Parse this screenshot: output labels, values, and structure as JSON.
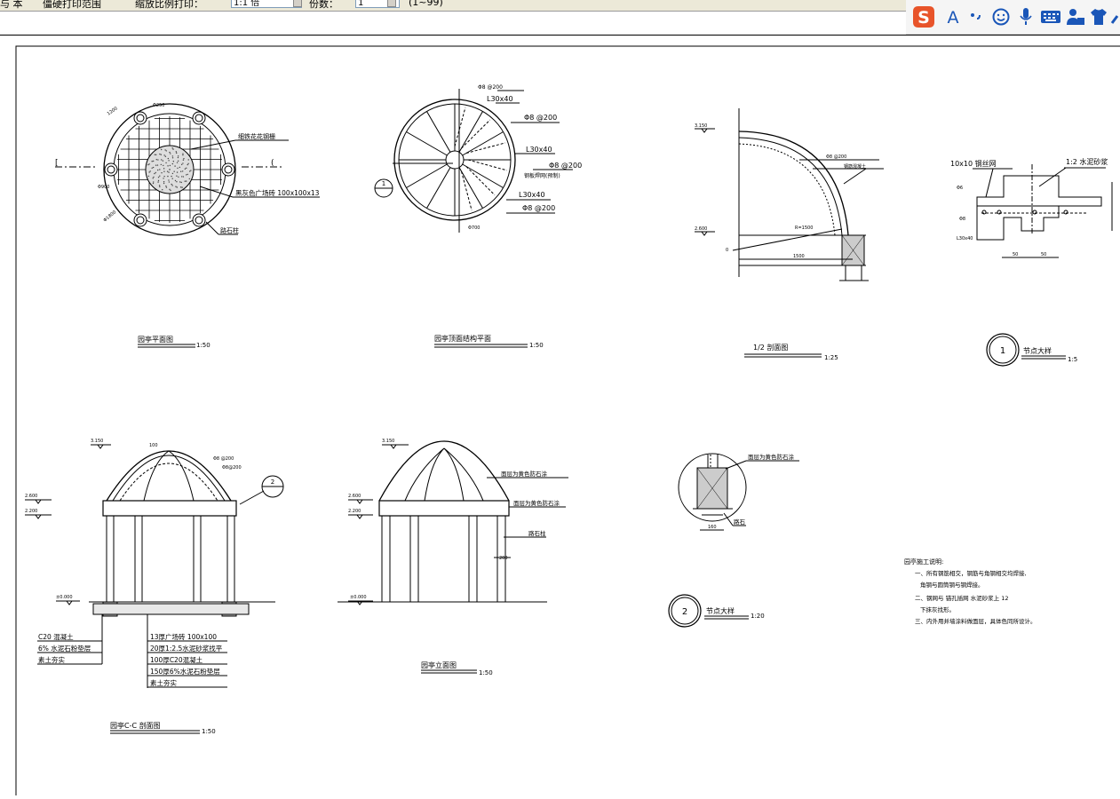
{
  "toolbar": {
    "title_fragment": "与 本",
    "mode_label": "僵硬打印范围",
    "scale_label": "缩放比例打印：",
    "scale_value": "1:1  倍",
    "copies_label": "份数：",
    "copies_value": "1",
    "range_text": "(1~99)"
  },
  "ime": {
    "logo_letter": "S",
    "text_letter": "A",
    "icons": [
      "punctuation-icon",
      "smiley-icon",
      "microphone-icon",
      "keyboard-icon",
      "user-tools-icon",
      "skin-shirt-icon",
      "wrench-icon"
    ]
  },
  "drawing": {
    "plan": {
      "title": "园亭平面图",
      "scale": "1:50",
      "labels": {
        "grate": "细铁花花钢栅",
        "tile": "黑灰色广场砖 100x100x13",
        "pillar": "路石柱",
        "dim_a": "1200",
        "dim_b": "Φ250",
        "dim_c": "Φ900",
        "dim_d": "Φ1800",
        "section_left": "[",
        "section_right": "("
      }
    },
    "roof_plan": {
      "title": "园亭顶面结构平面",
      "scale": "1:50",
      "marker": "1",
      "labels": [
        "Φ8  @200",
        "L30x40",
        "Φ8  @200",
        "L30x40",
        "Φ8  @200",
        "L30x40",
        "Φ8  @200",
        "L30x40",
        "钢板焊网(预制)",
        "Φ700"
      ]
    },
    "half_section": {
      "title": "1/2  剖面图",
      "scale": "1:25",
      "labels": {
        "top_elev": "3.150",
        "mid_elev": "2.600",
        "zero": "0",
        "rebar": "Φ8  @200",
        "steel": "钢筋混凝土",
        "radius": "R=1500",
        "span": "1500"
      }
    },
    "detail1": {
      "title": "节点大样",
      "scale": "1:5",
      "marker": "1",
      "labels": {
        "mesh": "10x10  钢丝网",
        "mortar": "1:2 水泥砂浆",
        "side_a": "Φ6",
        "side_b": "Φ8",
        "side_c": "L30x40",
        "dim_1": "50",
        "dim_2": "50"
      }
    },
    "section_cc": {
      "title": "园亭C-C 剖面图",
      "scale": "1:50",
      "labels": {
        "top": "3.150",
        "left_a": "2.600",
        "left_b": "2.200",
        "ground": "±0.000",
        "rebar": "Φ8  @200",
        "rebar2": "Φ8@200",
        "apex": "100",
        "marker": "2",
        "left_layers": [
          "C20 混凝土",
          "6% 水泥石粉垫层",
          "素土夯实"
        ],
        "right_layers": [
          "13厚广场砖        100x100",
          "20厚1:2.5水泥砂浆找平",
          "100厚C20混凝土",
          "150厚6%水泥石粉垫层",
          "素土夯实"
        ]
      }
    },
    "elevation": {
      "title": "园亭立面图",
      "scale": "1:50",
      "labels": {
        "top": "3.150",
        "left_a": "2.600",
        "left_b": "2.200",
        "ground": "±0.000",
        "roof": "面层为黄色防石涂",
        "beam": "面层为黄色防石涂",
        "column": "路石柱",
        "col_dim": "200"
      }
    },
    "detail2": {
      "title": "节点大样",
      "scale": "1:20",
      "marker": "2",
      "labels": {
        "finish": "面层为黄色防石涂",
        "stone": "路石",
        "dim": "160"
      }
    },
    "notes": {
      "title": "园亭施工说明:",
      "items": [
        "一、所有钢筋相交，钢筋与角钢相交均焊接,",
        "角钢与圆筒钢与钢焊接。",
        "二、钢网与    锚孔插网    水泥砂浆上 12",
        "下抹灰找形。",
        "三、内外用并墙涂料做面层，具体色同所设计。"
      ]
    }
  }
}
